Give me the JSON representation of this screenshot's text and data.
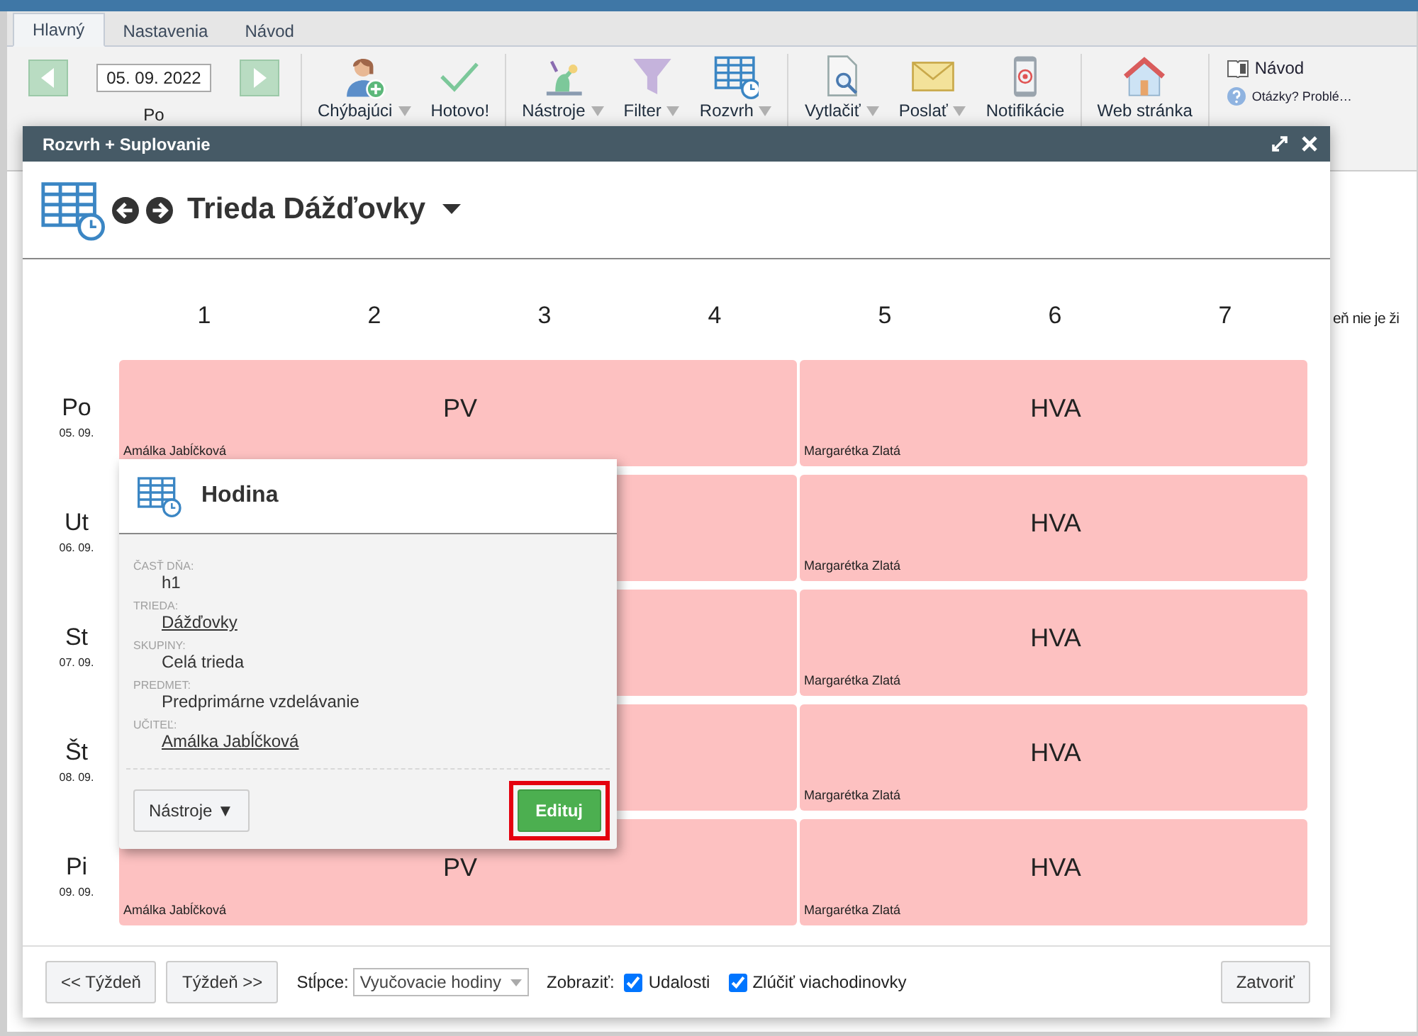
{
  "tabs": [
    {
      "label": "Hlavný",
      "selected": true
    },
    {
      "label": "Nastavenia",
      "selected": false
    },
    {
      "label": "Návod",
      "selected": false
    }
  ],
  "ribbon": {
    "date": {
      "value": "05. 09. 2022",
      "weekday": "Po"
    },
    "groups": [
      [
        {
          "label": "Chýbajúci",
          "dropdown": true
        },
        {
          "label": "Hotovo!",
          "dropdown": false
        }
      ],
      [
        {
          "label": "Nástroje",
          "dropdown": true
        },
        {
          "label": "Filter",
          "dropdown": true
        },
        {
          "label": "Rozvrh",
          "dropdown": true
        }
      ],
      [
        {
          "label": "Vytlačiť",
          "dropdown": true
        },
        {
          "label": "Poslať",
          "dropdown": true
        },
        {
          "label": "Notifikácie",
          "dropdown": false
        }
      ],
      [
        {
          "label": "Web stránka",
          "dropdown": false
        }
      ]
    ],
    "help_links": [
      "Návod",
      "Otázky? Problé…"
    ]
  },
  "background_text": "eň nie je ži",
  "dialog": {
    "title": "Rozvrh + Suplovanie",
    "heading": "Trieda Dážďovky",
    "columns": [
      "1",
      "2",
      "3",
      "4",
      "5",
      "6",
      "7"
    ],
    "days": [
      {
        "name": "Po",
        "date": "05. 09.",
        "lessons": [
          {
            "kind": "lesson",
            "subject": "PV",
            "teacher": "Amálka Jabĺčková"
          },
          {
            "kind": "lesson",
            "subject": "HVA",
            "teacher": "Margarétka Zlatá"
          }
        ]
      },
      {
        "name": "Ut",
        "date": "06. 09.",
        "lessons": [
          {
            "kind": "lesson"
          },
          {
            "kind": "lesson",
            "subject": "HVA",
            "teacher": "Margarétka Zlatá"
          }
        ]
      },
      {
        "name": "St",
        "date": "07. 09.",
        "lessons": [
          {
            "kind": "lesson"
          },
          {
            "kind": "lesson",
            "subject": "HVA",
            "teacher": "Margarétka Zlatá"
          }
        ]
      },
      {
        "name": "Št",
        "date": "08. 09.",
        "lessons": [
          {
            "kind": "lesson"
          },
          {
            "kind": "lesson",
            "subject": "HVA",
            "teacher": "Margarétka Zlatá"
          }
        ]
      },
      {
        "name": "Pi",
        "date": "09. 09.",
        "lessons": [
          {
            "kind": "lesson",
            "subject": "PV",
            "teacher": "Amálka Jabĺčková"
          },
          {
            "kind": "lesson",
            "subject": "HVA",
            "teacher": "Margarétka Zlatá"
          }
        ]
      }
    ],
    "popover": {
      "title": "Hodina",
      "fields": [
        {
          "label": "ČASŤ DŇA:",
          "value": "h1",
          "link": false
        },
        {
          "label": "TRIEDA:",
          "value": "Dážďovky",
          "link": true
        },
        {
          "label": "SKUPINY:",
          "value": "Celá trieda",
          "link": false
        },
        {
          "label": "PREDMET:",
          "value": "Predprimárne vzdelávanie",
          "link": false
        },
        {
          "label": "UČITEĽ:",
          "value": "Amálka Jabĺčková",
          "link": true
        }
      ],
      "tools_button": "Nástroje ▼",
      "edit_button": {
        "label": "Edituj",
        "highlighted": true
      }
    },
    "footer": {
      "prev_button": "<< Týždeň",
      "next_button": "Týždeň >>",
      "columns_label": "Stĺpce:",
      "columns_select": "Vyučovacie hodiny",
      "show_label": "Zobraziť:",
      "checkboxes": [
        {
          "label": "Udalosti",
          "checked": true
        },
        {
          "label": "Zlúčiť viachodinovky",
          "checked": true
        }
      ],
      "close_button": "Zatvoriť"
    }
  }
}
